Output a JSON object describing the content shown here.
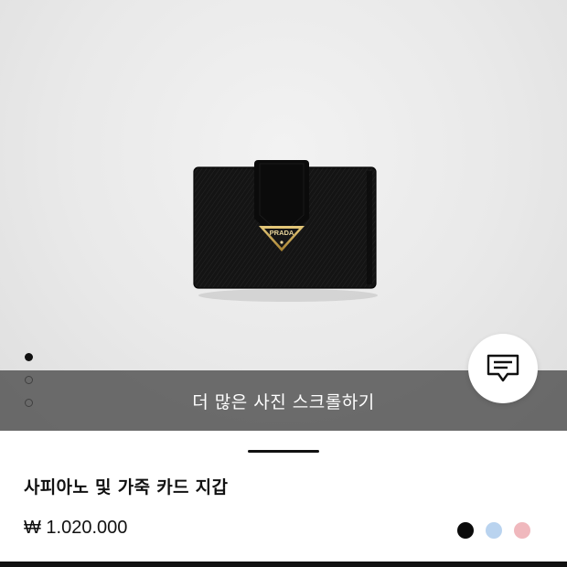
{
  "product": {
    "name": "사피아노 및 가죽 카드 지갑",
    "price": "₩ 1.020.000",
    "logo_text": "PRADA",
    "colors": [
      {
        "name": "black",
        "hex": "#0b0b0b"
      },
      {
        "name": "light-blue",
        "hex": "#b9d3ef"
      },
      {
        "name": "pink",
        "hex": "#f0b8bd"
      }
    ]
  },
  "gallery": {
    "scroll_hint": "더 많은 사진 스크롤하기",
    "total_images": 3,
    "current_index": 1
  },
  "chat": {
    "icon": "chat-bubble-icon"
  }
}
